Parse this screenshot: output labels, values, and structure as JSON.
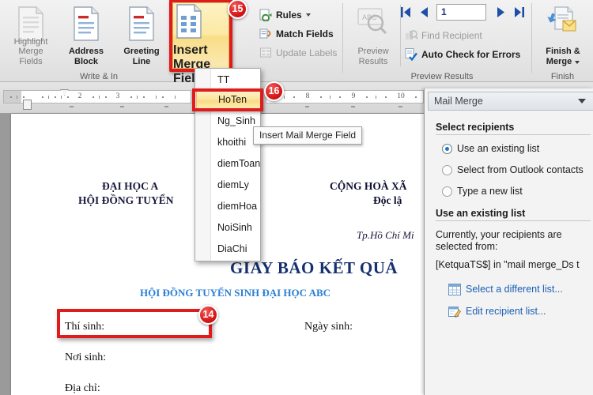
{
  "ribbon": {
    "groups": [
      {
        "label": "Write & In",
        "name": "write-insert-fields"
      },
      {
        "label": "Preview Results",
        "name": "preview-results"
      },
      {
        "label": "Finish",
        "name": "finish"
      }
    ],
    "write_insert": {
      "highlight_merge_fields": "Highlight\nMerge Fields",
      "highlight_line1": "Highlight",
      "highlight_line2": "Merge Fields",
      "address_line1": "Address",
      "address_line2": "Block",
      "greeting_line1": "Greeting",
      "greeting_line2": "Line",
      "insert_line1": "Insert Merge",
      "insert_line2": "Field",
      "rules": "Rules",
      "match_fields": "Match Fields",
      "update_labels": "Update Labels"
    },
    "preview": {
      "preview_line1": "Preview",
      "preview_line2": "Results",
      "find_recipient": "Find Recipient",
      "auto_check": "Auto Check for Errors",
      "record_number": "1"
    },
    "finish": {
      "finish_line1": "Finish &",
      "finish_line2": "Merge"
    }
  },
  "ruler": {
    "left_numbers": [
      "2",
      "3"
    ],
    "right_numbers": [
      "8",
      "9",
      "10"
    ]
  },
  "merge_menu": {
    "items": [
      {
        "label": "TT",
        "selected": false
      },
      {
        "label": "HoTen",
        "selected": true
      },
      {
        "label": "Ng_Sinh",
        "selected": false
      },
      {
        "label": "khoithi",
        "selected": false
      },
      {
        "label": "diemToan",
        "selected": false
      },
      {
        "label": "diemLy",
        "selected": false
      },
      {
        "label": "diemHoa",
        "selected": false
      },
      {
        "label": "NoiSinh",
        "selected": false
      },
      {
        "label": "DiaChi",
        "selected": false
      }
    ],
    "tooltip": "Insert Mail Merge Field"
  },
  "document": {
    "header_left_line1": "ĐẠI HỌC A",
    "header_left_line2": "HỘI ĐỒNG TUYỂN",
    "header_right_line1": "CỘNG HOÀ XÃ",
    "header_right_line2": "Độc lậ",
    "place_date": "Tp.Hồ Chí Mi",
    "title": "GIAY BÁO KẾT QUẢ",
    "subtitle": "HỘI ĐỒNG TUYỂN SINH ĐẠI HỌC ABC",
    "field_thisinh": "Thí sinh:",
    "field_ngaysinh": "Ngày sinh:",
    "field_noisinh": "Nơi sinh:",
    "field_diachi": "Địa chỉ:"
  },
  "task_pane": {
    "title": "Mail Merge",
    "section_select_recipients": "Select recipients",
    "radios": [
      {
        "label": "Use an existing list",
        "checked": true
      },
      {
        "label": "Select from Outlook contacts",
        "checked": false
      },
      {
        "label": "Type a new list",
        "checked": false
      }
    ],
    "section_use_existing": "Use an existing list",
    "currently_text": "Currently, your recipients are selected from:",
    "source_text": "[KetquaTS$] in \"mail merge_Ds t",
    "link_select_different": "Select a different list...",
    "link_edit_recipient": "Edit recipient list..."
  },
  "badges": [
    {
      "number": "14",
      "name": "badge-14"
    },
    {
      "number": "15",
      "name": "badge-15"
    },
    {
      "number": "16",
      "name": "badge-16"
    }
  ],
  "colors": {
    "annotation_red": "#e01b1b",
    "highlight_yellow": "#f9dd86",
    "link_blue": "#1d5fb5",
    "doc_title_blue": "#15306e",
    "doc_subtitle_blue": "#2a7fd4"
  }
}
